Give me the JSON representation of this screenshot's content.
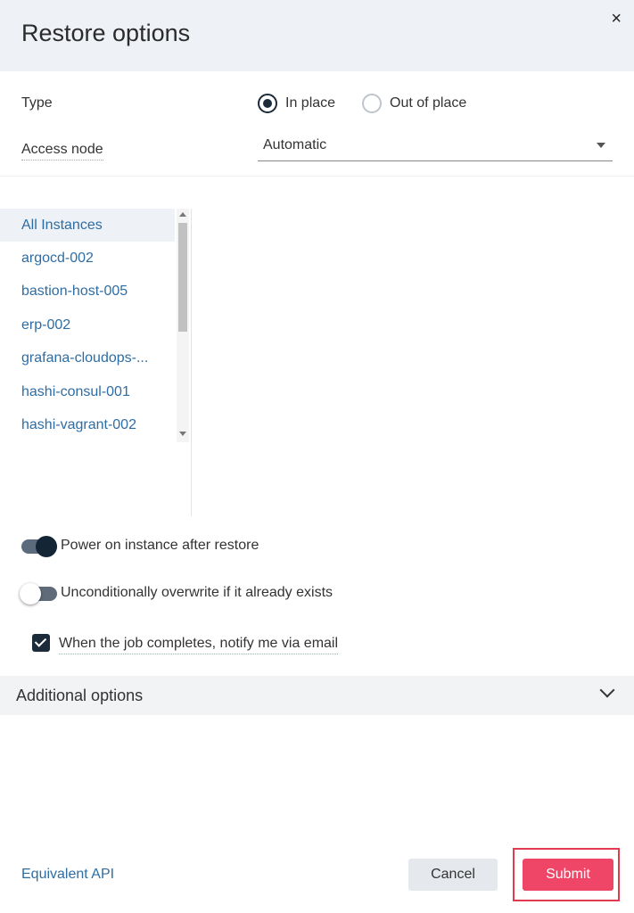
{
  "dialog": {
    "title": "Restore options",
    "close_glyph": "×"
  },
  "type_field": {
    "label": "Type",
    "options": [
      {
        "label": "In place",
        "selected": true
      },
      {
        "label": "Out of place",
        "selected": false
      }
    ]
  },
  "access_node": {
    "label": "Access node",
    "value": "Automatic"
  },
  "instances": {
    "items": [
      "All Instances",
      "argocd-002",
      "bastion-host-005",
      "erp-002",
      "grafana-cloudops-...",
      "hashi-consul-001",
      "hashi-vagrant-002"
    ],
    "selected_index": 0
  },
  "toggles": [
    {
      "label": "Power on instance after restore",
      "on": true
    },
    {
      "label": "Unconditionally overwrite if it already exists",
      "on": false
    }
  ],
  "notify": {
    "label": "When the job completes, notify me via email",
    "checked": true
  },
  "additional": {
    "label": "Additional options"
  },
  "footer": {
    "api_link": "Equivalent API",
    "cancel": "Cancel",
    "submit": "Submit"
  },
  "colors": {
    "accent": "#ef4566",
    "link": "#2e6da4",
    "dark": "#1c2b3a"
  }
}
